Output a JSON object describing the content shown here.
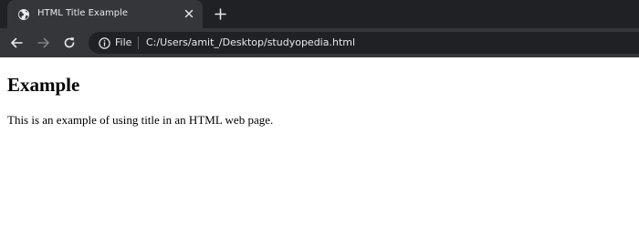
{
  "browser": {
    "tab": {
      "title": "HTML Title Example",
      "favicon": "globe-icon",
      "close_icon": "close-icon"
    },
    "new_tab_icon": "plus-icon",
    "toolbar": {
      "back_icon": "arrow-left-icon",
      "forward_icon": "arrow-right-icon",
      "reload_icon": "reload-icon",
      "info_icon": "info-icon",
      "scheme_label": "File",
      "url": "C:/Users/amit_/Desktop/studyopedia.html"
    },
    "colors": {
      "tabstrip_bg": "#202124",
      "toolbar_bg": "#35363a",
      "omnibox_bg": "#202124",
      "text": "#e8eaed",
      "forward_disabled": "#7c7f84"
    }
  },
  "page": {
    "heading": "Example",
    "paragraph": "This is an example of using title in an HTML web page."
  }
}
